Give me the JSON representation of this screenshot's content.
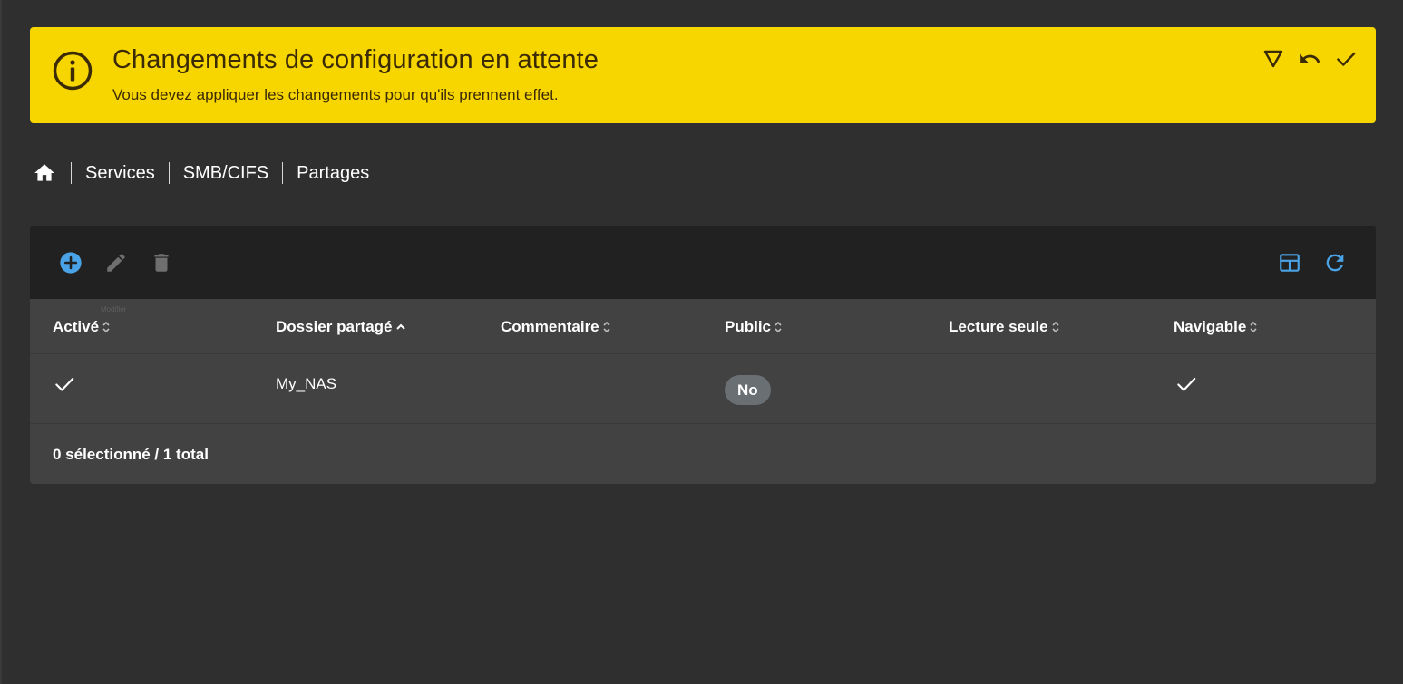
{
  "alert": {
    "title": "Changements de configuration en attente",
    "message": "Vous devez appliquer les changements pour qu'ils prennent effet.",
    "icon": "info-icon",
    "actions": [
      "filter-icon",
      "undo-icon",
      "check-icon"
    ],
    "color": "#f7d600"
  },
  "breadcrumb": {
    "home_icon": "home-icon",
    "items": [
      "Services",
      "SMB/CIFS",
      "Partages"
    ]
  },
  "toolbar": {
    "left_icons": [
      "add-circle-icon",
      "edit-icon",
      "delete-icon"
    ],
    "right_icons": [
      "table-view-icon",
      "refresh-icon"
    ],
    "tooltip": "Modifier",
    "accent": "#4aa3e6"
  },
  "table": {
    "columns": [
      "Activé",
      "Dossier partagé",
      "Commentaire",
      "Public",
      "Lecture seule",
      "Navigable"
    ],
    "sorted_column": "Dossier partagé",
    "rows": [
      {
        "enabled": true,
        "shared_folder": "My_NAS",
        "comment": "",
        "public": "No",
        "read_only": "",
        "browsable": true
      }
    ],
    "footer": "0 sélectionné / 1 total"
  }
}
